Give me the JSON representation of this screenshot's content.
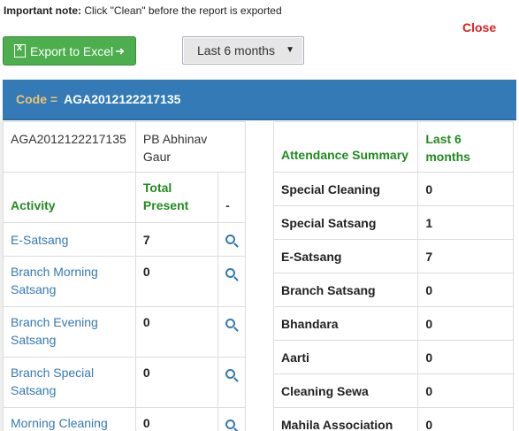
{
  "note": {
    "prefix": "Important note:",
    "text": " Click \"Clean\" before the report is exported"
  },
  "close_label": "Close",
  "export_label": "Export to Excel",
  "period": {
    "selected": "Last 6 months"
  },
  "code": {
    "label": "Code =",
    "value": "AGA2012122217135"
  },
  "profile": {
    "id": "AGA2012122217135",
    "name": "PB Abhinav Gaur"
  },
  "activity_table": {
    "headers": {
      "activity": "Activity",
      "total": "Total Present",
      "action": "-"
    },
    "rows": [
      {
        "activity": "E-Satsang",
        "total": "7"
      },
      {
        "activity": "Branch Morning Satsang",
        "total": "0"
      },
      {
        "activity": "Branch Evening Satsang",
        "total": "0"
      },
      {
        "activity": "Branch Special Satsang",
        "total": "0"
      },
      {
        "activity": "Morning Cleaning",
        "total": "0"
      }
    ]
  },
  "summary_table": {
    "headers": {
      "label": "Attendance Summary",
      "period": "Last 6 months"
    },
    "rows": [
      {
        "label": "Special Cleaning",
        "value": "0"
      },
      {
        "label": "Special Satsang",
        "value": "1"
      },
      {
        "label": "E-Satsang",
        "value": "7"
      },
      {
        "label": "Branch Satsang",
        "value": "0"
      },
      {
        "label": "Bhandara",
        "value": "0"
      },
      {
        "label": "Aarti",
        "value": "0"
      },
      {
        "label": "Cleaning Sewa",
        "value": "0"
      },
      {
        "label": "Mahila Association",
        "value": "0"
      }
    ]
  },
  "colors": {
    "header_bar": "#337ab7",
    "code_label": "#f0c36d",
    "export_button": "#4cae4c",
    "close": "#e02020",
    "green_header": "#1f8c1f"
  }
}
